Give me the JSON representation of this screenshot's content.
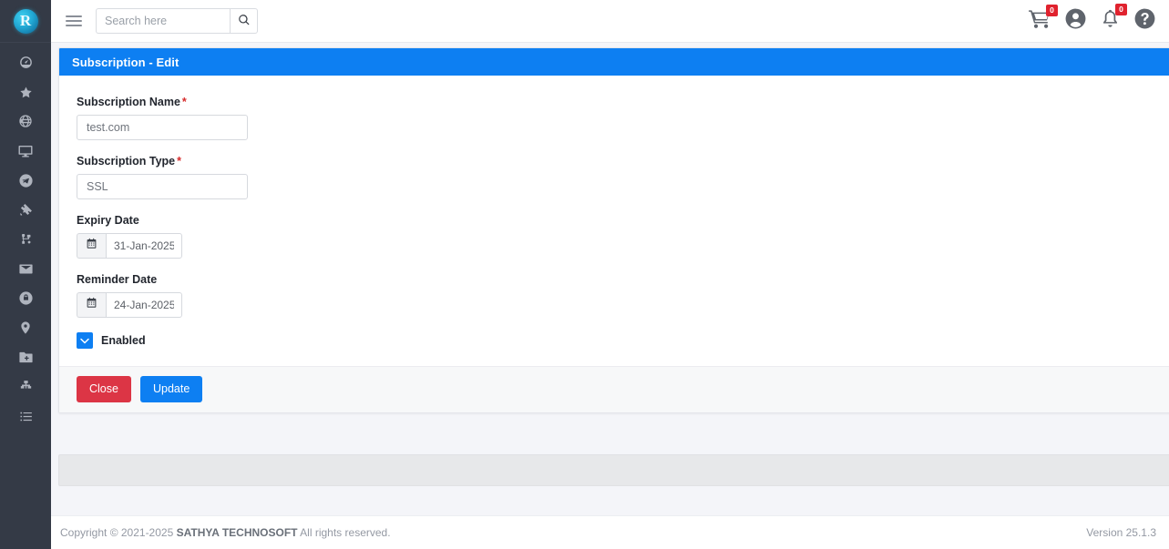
{
  "sidebar": {
    "logo_text": "R",
    "items": [
      {
        "name": "dashboard",
        "icon": "gauge-icon"
      },
      {
        "name": "favorites",
        "icon": "star-icon"
      },
      {
        "name": "domains",
        "icon": "globe-icon"
      },
      {
        "name": "monitors",
        "icon": "monitor-icon"
      },
      {
        "name": "send",
        "icon": "send-icon"
      },
      {
        "name": "satellite",
        "icon": "satellite-icon"
      },
      {
        "name": "network",
        "icon": "sitemap-icon"
      },
      {
        "name": "mail",
        "icon": "envelope-icon"
      },
      {
        "name": "security",
        "icon": "lock-icon"
      },
      {
        "name": "locations",
        "icon": "map-pin-icon"
      },
      {
        "name": "add-folder",
        "icon": "folder-plus-icon"
      },
      {
        "name": "hierarchy",
        "icon": "org-chart-icon"
      },
      {
        "name": "reports",
        "icon": "list-icon"
      }
    ]
  },
  "topbar": {
    "menu_toggle": "hamburger-icon",
    "search": {
      "placeholder": "Search here",
      "value": ""
    },
    "search_button_icon": "search-icon",
    "cart": {
      "icon": "cart-icon",
      "badge": "0"
    },
    "account": {
      "icon": "user-circle-icon"
    },
    "notifications": {
      "icon": "bell-icon",
      "badge": "0"
    },
    "help": {
      "icon": "question-circle-icon"
    }
  },
  "card": {
    "title": "Subscription - Edit",
    "accent_color": "#0d7ff2",
    "fields": {
      "subscription_name": {
        "label": "Subscription Name",
        "required_marker": "*",
        "value": "test.com"
      },
      "subscription_type": {
        "label": "Subscription Type",
        "required_marker": "*",
        "value": "SSL"
      },
      "expiry_date": {
        "label": "Expiry Date",
        "value": "31-Jan-2025",
        "icon": "calendar-icon"
      },
      "reminder_date": {
        "label": "Reminder Date",
        "value": "24-Jan-2025",
        "icon": "calendar-icon"
      },
      "enabled": {
        "label": "Enabled",
        "checked": true
      }
    },
    "buttons": {
      "close": {
        "label": "Close",
        "color": "#dc3545"
      },
      "update": {
        "label": "Update",
        "color": "#0d7ff2"
      }
    }
  },
  "footer": {
    "copyright_prefix": "Copyright © 2021-2025 ",
    "company": "SATHYA TECHNOSOFT",
    "copyright_suffix": " All rights reserved.",
    "version": "Version 25.1.3"
  }
}
